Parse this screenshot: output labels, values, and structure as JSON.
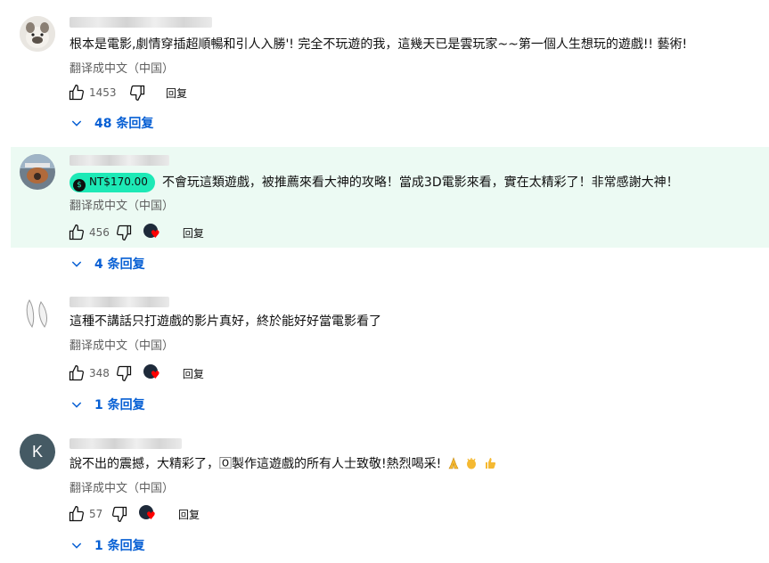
{
  "comments": [
    {
      "text": "根本是電影,劇情穿插超順暢和引人入勝'! 完全不玩遊的我，這幾天已是雲玩家~~第一個人生想玩的遊戲!! 藝術!",
      "translate": "翻译成中文（中国）",
      "likes": "1453",
      "reply_label": "回复",
      "replies": "48 条回复",
      "avatar": "bulldog-avatar"
    },
    {
      "super_thanks": "NT$170.00",
      "super_thanks_icon": "dollar-coin-icon",
      "text": "不會玩這類遊戲，被推薦來看大神的攻略！當成3D電影來看，實在太精彩了！非常感謝大神！",
      "translate": "翻译成中文（中国）",
      "likes": "456",
      "reply_label": "回复",
      "replies": "4 条回复",
      "hearted": true,
      "highlight_color": "#ecfaf3"
    },
    {
      "text": "這種不講話只打遊戲的影片真好，終於能好好當電影看了",
      "translate": "翻译成中文（中国）",
      "likes": "348",
      "reply_label": "回复",
      "replies": "1 条回复",
      "hearted": true
    },
    {
      "avatar_letter": "K",
      "text": "說不出的震撼，大精彩了，🄾製作這遊戲的所有人士致敬!熱烈喝采!",
      "emojis": [
        "folded-hands-icon",
        "clapping-hands-icon",
        "thumbs-up-icon"
      ],
      "translate": "翻译成中文（中国）",
      "likes": "57",
      "reply_label": "回复",
      "replies": "1 条回复",
      "hearted": true
    }
  ],
  "colors": {
    "link": "#065fd4",
    "muted": "#606060",
    "super_chip": "#1de9b6",
    "heart": "#ff0000",
    "avatar_k": "#455a64"
  }
}
